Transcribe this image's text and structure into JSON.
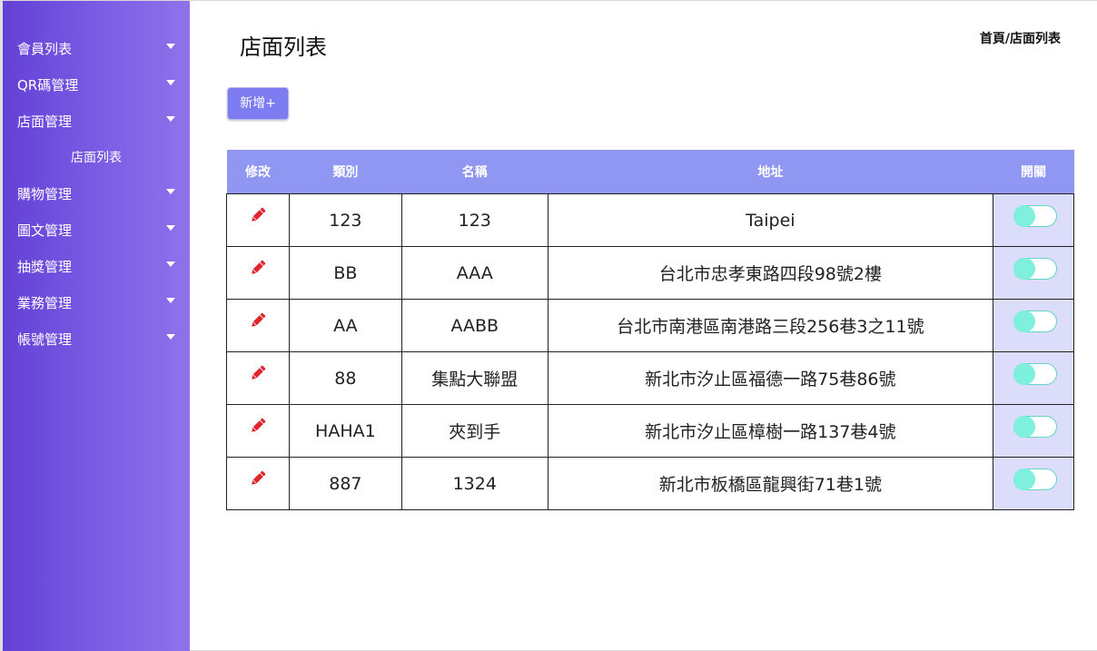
{
  "sidebar": {
    "items": [
      {
        "label": "會員列表"
      },
      {
        "label": "QR碼管理"
      },
      {
        "label": "店面管理",
        "subitems": [
          {
            "label": "店面列表"
          }
        ]
      },
      {
        "label": "購物管理"
      },
      {
        "label": "圖文管理"
      },
      {
        "label": "抽獎管理"
      },
      {
        "label": "業務管理"
      },
      {
        "label": "帳號管理"
      }
    ]
  },
  "header": {
    "title": "店面列表",
    "breadcrumb": {
      "home": "首頁",
      "separator": "/",
      "current": "店面列表"
    }
  },
  "toolbar": {
    "add_label": "新增+"
  },
  "table": {
    "columns": [
      "修改",
      "類別",
      "名稱",
      "地址",
      "開關"
    ],
    "rows": [
      {
        "category": "123",
        "name": "123",
        "address": "Taipei"
      },
      {
        "category": "BB",
        "name": "AAA",
        "address": "台北市忠孝東路四段98號2樓"
      },
      {
        "category": "AA",
        "name": "AABB",
        "address": "台北市南港區南港路三段256巷3之11號"
      },
      {
        "category": "88",
        "name": "集點大聯盟",
        "address": "新北市汐止區福德一路75巷86號"
      },
      {
        "category": "HAHA1",
        "name": "夾到手",
        "address": "新北市汐止區樟樹一路137巷4號"
      },
      {
        "category": "887",
        "name": "1324",
        "address": "新北市板橋區龍興街71巷1號"
      }
    ]
  },
  "icons": {
    "edit": "pencil-icon",
    "menu_caret": "caret-down-icon"
  },
  "colors": {
    "sidebar_start": "#6441d6",
    "sidebar_end": "#8f72ea",
    "table_header": "#8f97f2",
    "button": "#7d7cf0",
    "edit_icon": "#e0252f",
    "toggle_knob": "#7ef0dc",
    "toggle_cell": "#dcdcfb"
  }
}
